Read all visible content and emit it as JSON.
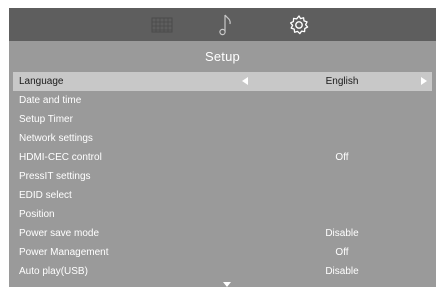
{
  "tabs": [
    {
      "icon": "picture-grid-icon"
    },
    {
      "icon": "music-note-icon"
    },
    {
      "icon": "gear-icon",
      "active": true
    }
  ],
  "header": {
    "title": "Setup"
  },
  "menu": {
    "items": [
      {
        "label": "Language",
        "value": "English"
      },
      {
        "label": "Date and time",
        "value": ""
      },
      {
        "label": "Setup Timer",
        "value": ""
      },
      {
        "label": "Network settings",
        "value": ""
      },
      {
        "label": "HDMI-CEC control",
        "value": "Off"
      },
      {
        "label": "PressIT settings",
        "value": ""
      },
      {
        "label": "EDID select",
        "value": ""
      },
      {
        "label": "Position",
        "value": ""
      },
      {
        "label": "Power save mode",
        "value": "Disable"
      },
      {
        "label": "Power Management",
        "value": "Off"
      },
      {
        "label": "Auto play(USB)",
        "value": "Disable"
      }
    ]
  },
  "colors": {
    "panel": "#9a9a9a",
    "topbar": "#5e5e5e",
    "selected_row": "#c8c8c8",
    "text": "#ffffff"
  }
}
